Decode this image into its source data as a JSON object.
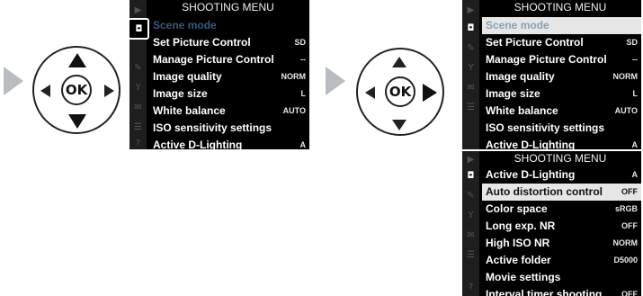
{
  "menu_title": "SHOOTING MENU",
  "ok_label": "OK",
  "sidebar_icons": [
    "playback-icon",
    "camera-icon",
    "pencil-icon",
    "wrench-icon",
    "retouch-icon",
    "recent-settings-icon",
    "help-icon"
  ],
  "screen1": {
    "rows": [
      {
        "label": "Scene mode",
        "value": "",
        "state": "dim"
      },
      {
        "label": "Set Picture Control",
        "value": "SD",
        "state": "normal"
      },
      {
        "label": "Manage Picture Control",
        "value": "--",
        "state": "normal"
      },
      {
        "label": "Image quality",
        "value": "NORM",
        "state": "normal"
      },
      {
        "label": "Image size",
        "value": "L",
        "state": "normal"
      },
      {
        "label": "White balance",
        "value": "AUTO",
        "state": "normal"
      },
      {
        "label": "ISO sensitivity settings",
        "value": "",
        "state": "normal"
      },
      {
        "label": "Active D-Lighting",
        "value": "A",
        "state": "normal"
      }
    ]
  },
  "screen2": {
    "rows": [
      {
        "label": "Scene mode",
        "value": "",
        "state": "hl"
      },
      {
        "label": "Set Picture Control",
        "value": "SD",
        "state": "normal"
      },
      {
        "label": "Manage Picture Control",
        "value": "--",
        "state": "normal"
      },
      {
        "label": "Image quality",
        "value": "NORM",
        "state": "normal"
      },
      {
        "label": "Image size",
        "value": "L",
        "state": "normal"
      },
      {
        "label": "White balance",
        "value": "AUTO",
        "state": "normal"
      },
      {
        "label": "ISO sensitivity settings",
        "value": "",
        "state": "normal"
      },
      {
        "label": "Active D-Lighting",
        "value": "A",
        "state": "normal"
      }
    ]
  },
  "screen3": {
    "rows": [
      {
        "label": "Active D-Lighting",
        "value": "A",
        "state": "normal"
      },
      {
        "label": "Auto distortion control",
        "value": "OFF",
        "state": "hl"
      },
      {
        "label": "Color space",
        "value": "sRGB",
        "state": "normal"
      },
      {
        "label": "Long exp. NR",
        "value": "OFF",
        "state": "normal"
      },
      {
        "label": "High ISO NR",
        "value": "NORM",
        "state": "normal"
      },
      {
        "label": "Active folder",
        "value": "D5000",
        "state": "normal"
      },
      {
        "label": "Movie settings",
        "value": "",
        "state": "normal"
      },
      {
        "label": "Interval timer shooting",
        "value": "OFF",
        "state": "normal"
      }
    ]
  }
}
